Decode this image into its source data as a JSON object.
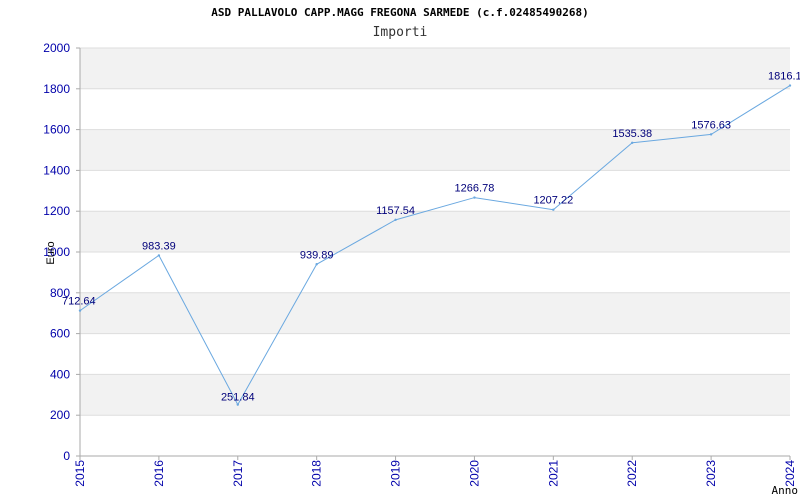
{
  "chart_data": {
    "type": "line",
    "title": "ASD PALLAVOLO CAPP.MAGG FREGONA SARMEDE (c.f.02485490268)",
    "subtitle": "Importi",
    "xlabel": "Anno",
    "ylabel": "Euro",
    "x": [
      "2015",
      "2016",
      "2017",
      "2018",
      "2019",
      "2020",
      "2021",
      "2022",
      "2023",
      "2024"
    ],
    "values": [
      712.64,
      983.39,
      251.84,
      939.89,
      1157.54,
      1266.78,
      1207.22,
      1535.38,
      1576.63,
      1816.1
    ],
    "labels": [
      "712.64",
      "983.39",
      "251.84",
      "939.89",
      "1157.54",
      "1266.78",
      "1207.22",
      "1535.38",
      "1576.63",
      "1816.1"
    ],
    "ylim": [
      0,
      2000
    ],
    "yticks": [
      "0",
      "200",
      "400",
      "600",
      "800",
      "1000",
      "1200",
      "1400",
      "1600",
      "1800",
      "2000"
    ],
    "grid": true,
    "line_color": "#6aa8e0",
    "band_color": "#f2f2f2",
    "tick_color": "#0000aa"
  }
}
